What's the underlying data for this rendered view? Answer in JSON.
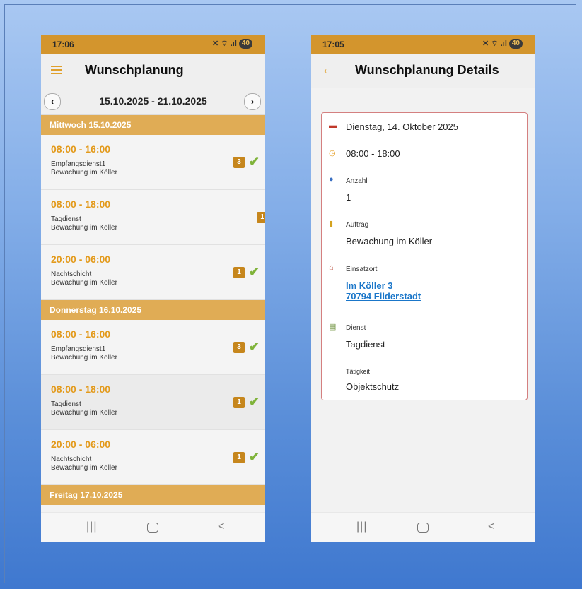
{
  "left": {
    "status": {
      "time": "17:06",
      "icons": "✕ ⌔ .ıl",
      "battery": "40"
    },
    "title": "Wunschplanung",
    "range": "15.10.2025 - 21.10.2025",
    "days": [
      {
        "header": "Mittwoch 15.10.2025"
      },
      {
        "header": "Donnerstag 16.10.2025"
      },
      {
        "header": "Freitag 17.10.2025"
      }
    ],
    "shifts": [
      {
        "time": "08:00 - 16:00",
        "line1": "Empfangsdienst1",
        "line2": "Bewachung im Köller",
        "count": "3",
        "checked": true
      },
      {
        "time": "08:00 - 18:00",
        "line1": "Tagdienst",
        "line2": "Bewachung im Köller",
        "count": "1",
        "checked": false
      },
      {
        "time": "20:00 - 06:00",
        "line1": "Nachtschicht",
        "line2": "Bewachung im Köller",
        "count": "1",
        "checked": true
      },
      {
        "time": "08:00 - 16:00",
        "line1": "Empfangsdienst1",
        "line2": "Bewachung im Köller",
        "count": "3",
        "checked": true
      },
      {
        "time": "08:00 - 18:00",
        "line1": "Tagdienst",
        "line2": "Bewachung im Köller",
        "count": "1",
        "checked": true
      },
      {
        "time": "20:00 - 06:00",
        "line1": "Nachtschicht",
        "line2": "Bewachung im Köller",
        "count": "1",
        "checked": true
      }
    ],
    "nav": {
      "recent": "|||",
      "back": "<"
    }
  },
  "right": {
    "status": {
      "time": "17:05",
      "icons": "✕ ⌔ .ıl",
      "battery": "40"
    },
    "title": "Wunschplanung Details",
    "date": "Dienstag, 14. Oktober 2025",
    "time": "08:00 - 18:00",
    "anzahl_label": "Anzahl",
    "anzahl_value": "1",
    "auftrag_label": "Auftrag",
    "auftrag_value": "Bewachung im Köller",
    "einsatzort_label": "Einsatzort",
    "address_line1": "Im Köller 3",
    "address_line2": "70794 Filderstadt",
    "dienst_label": "Dienst",
    "dienst_value": "Tagdienst",
    "taetigkeit_label": "Tätigkeit",
    "taetigkeit_value": "Objektschutz",
    "nav": {
      "recent": "|||",
      "back": "<"
    }
  },
  "colors": {
    "accent": "#e39a1b",
    "status_bar": "#d3952d",
    "day_header": "#e0ac55",
    "badge": "#c6861c",
    "check": "#7fb33a",
    "link": "#1a76c9"
  },
  "icons": [
    "menu-icon",
    "back-arrow-icon",
    "chevron-left-icon",
    "chevron-right-icon",
    "check-icon",
    "calendar-icon",
    "clock-icon",
    "people-icon",
    "document-icon",
    "house-icon",
    "id-card-icon"
  ]
}
